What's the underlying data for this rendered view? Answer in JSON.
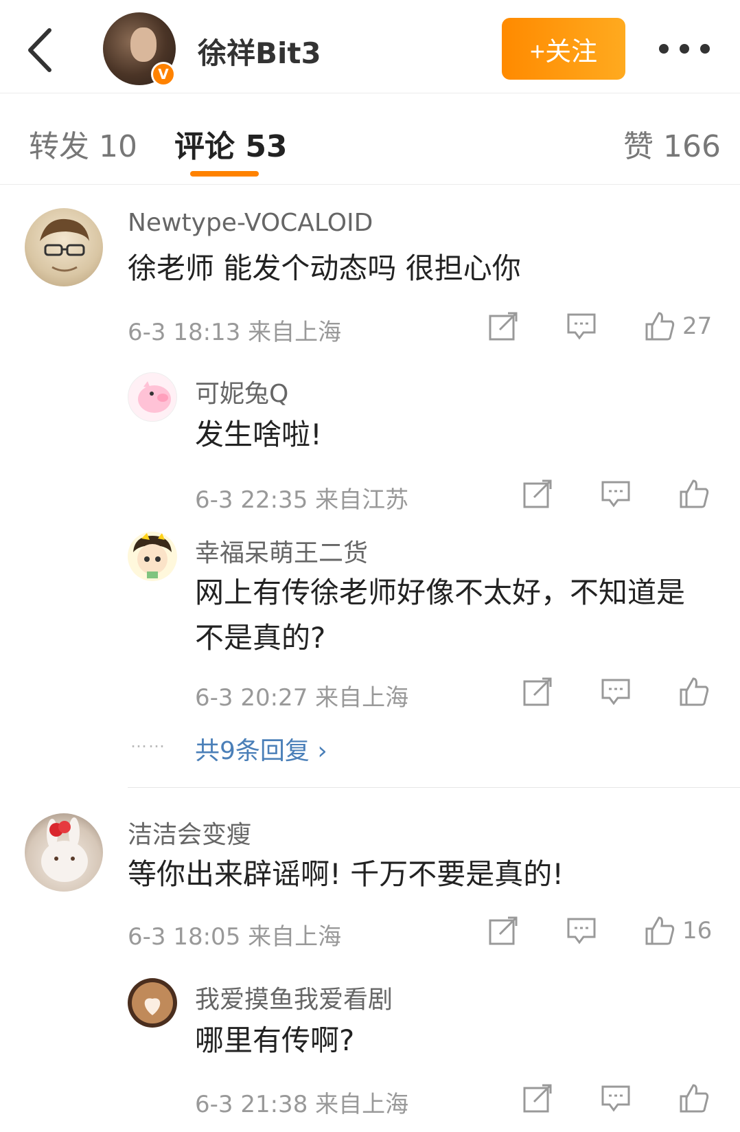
{
  "header": {
    "profile_name": "徐祥Bit3",
    "verified_mark": "V",
    "follow_label": "+关注"
  },
  "tabs": [
    {
      "label": "转发 10"
    },
    {
      "label": "评论 53"
    },
    {
      "label": "赞 166"
    }
  ],
  "comments": [
    {
      "user": "Newtype-VOCALOID",
      "text": "徐老师  能发个动态吗 很担心你",
      "meta": "6-3 18:13  来自上海",
      "likes": "27",
      "replies": [
        {
          "user": "可妮兔Q",
          "text": "发生啥啦!",
          "meta": "6-3 22:35  来自江苏"
        },
        {
          "user": "幸福呆萌王二货",
          "text": "网上有传徐老师好像不太好，不知道是不是真的?",
          "meta": "6-3 20:27  来自上海"
        }
      ],
      "more_replies": "共9条回复 ›"
    },
    {
      "user": "洁洁会变瘦",
      "text": "等你出来辟谣啊!  千万不要是真的!",
      "meta": "6-3 18:05  来自上海",
      "likes": "16",
      "replies": [
        {
          "user": "我爱摸鱼我爱看剧",
          "text": "哪里有传啊?",
          "meta": "6-3 21:38  来自上海"
        }
      ]
    }
  ],
  "colors": {
    "accent": "#ff8200",
    "link": "#4a7fb8"
  },
  "icons": {
    "back": "chevron-left-icon",
    "forward": "share-icon",
    "comment": "comment-icon",
    "like": "thumbs-up-icon",
    "more": "more-dots-icon"
  }
}
